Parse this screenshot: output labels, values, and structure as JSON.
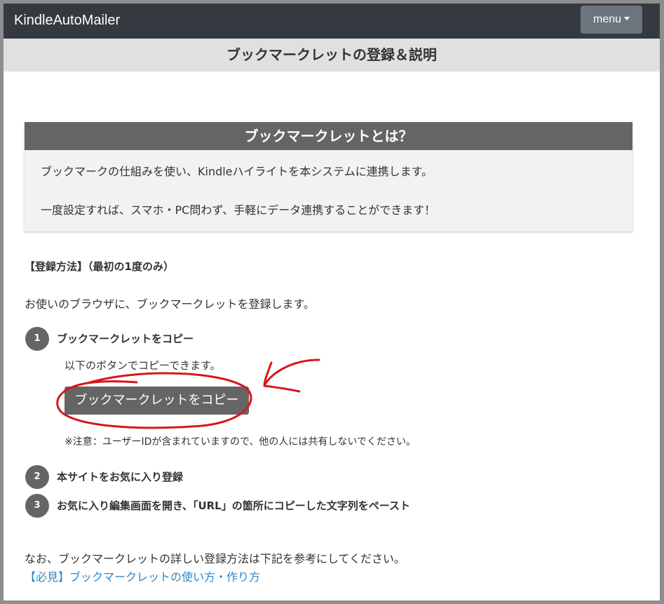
{
  "navbar": {
    "brand": "KindleAutoMailer",
    "menu_label": "menu"
  },
  "page_title": "ブックマークレットの登録＆説明",
  "intro_card": {
    "heading": "ブックマークレットとは？",
    "line1": "ブックマークの仕組みを使い、Kindleハイライトを本システムに連携します。",
    "line2": "一度設定すれば、スマホ・PC問わず、手軽にデータ連携することができます！"
  },
  "registration": {
    "section_title": "【登録方法】（最初の1度のみ）",
    "intro": "お使いのブラウザに、ブックマークレットを登録します。",
    "steps": [
      {
        "number": "1",
        "title": "ブックマークレットをコピー",
        "description": "以下のボタンでコピーできます。"
      },
      {
        "number": "2",
        "title": "本サイトをお気に入り登録"
      },
      {
        "number": "3",
        "title": "お気に入り編集画面を開き、「URL」の箇所にコピーした文字列をペースト"
      }
    ],
    "copy_button": "ブックマークレットをコピー",
    "note": "※注意：ユーザーIDが含まれていますので、他の人には共有しないでください。"
  },
  "footer": {
    "text": "なお、ブックマークレットの詳しい登録方法は下記を参考にしてください。",
    "link": "【必見】ブックマークレットの使い方・作り方"
  },
  "colors": {
    "navbar_bg": "#343a40",
    "title_bar_bg": "#e0e0e0",
    "card_header_bg": "#656565",
    "card_bg": "#f2f2f2",
    "link": "#2f86c9",
    "annotation": "#d9161c"
  }
}
